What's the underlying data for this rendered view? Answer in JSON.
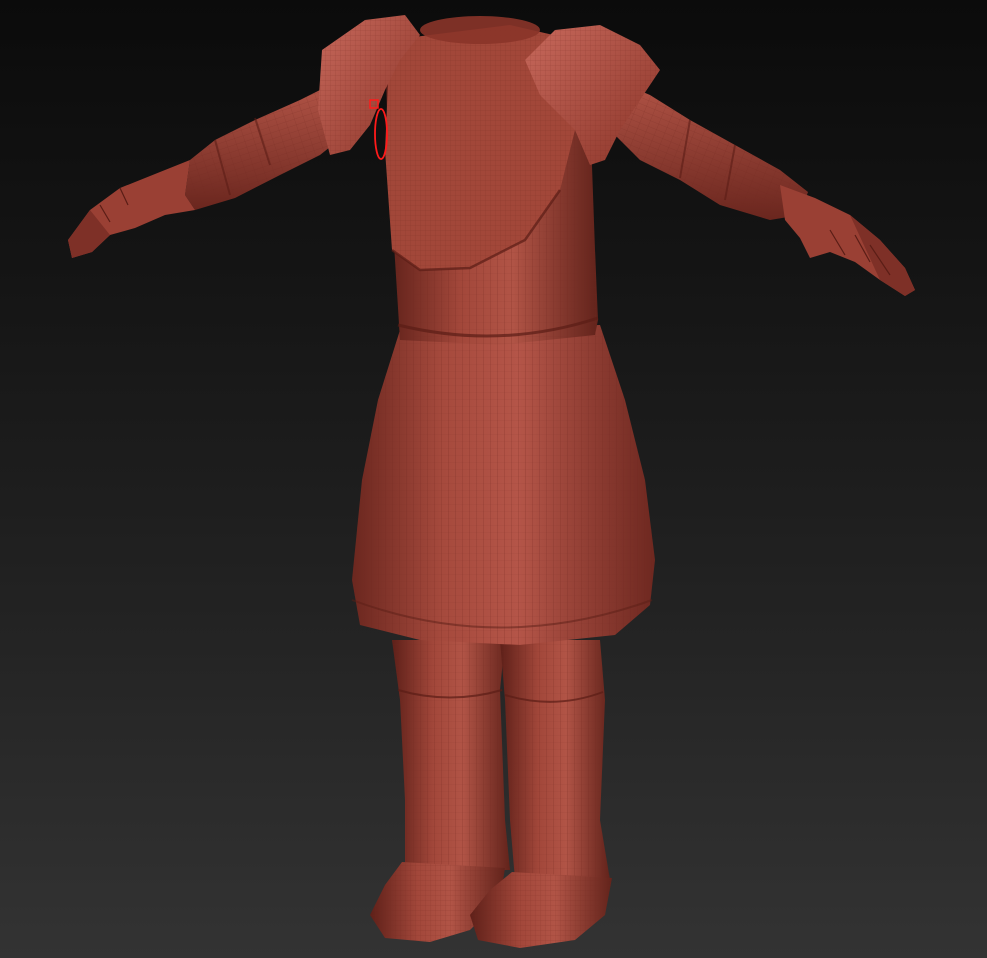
{
  "viewport": {
    "background_top": "#0b0b0b",
    "background_bottom": "#333333"
  },
  "model": {
    "material_color": "#9c3f33",
    "material_shadow": "#5e2019",
    "material_highlight": "#c2665a",
    "wireframe_color": "#7a2b22",
    "pose": "T-pose",
    "parts": [
      "torso",
      "shoulder-pads",
      "arms",
      "hands",
      "tunic-skirt",
      "legs",
      "boots"
    ]
  },
  "brush_cursor": {
    "color": "#ff1a1a",
    "shape": "ellipse"
  }
}
